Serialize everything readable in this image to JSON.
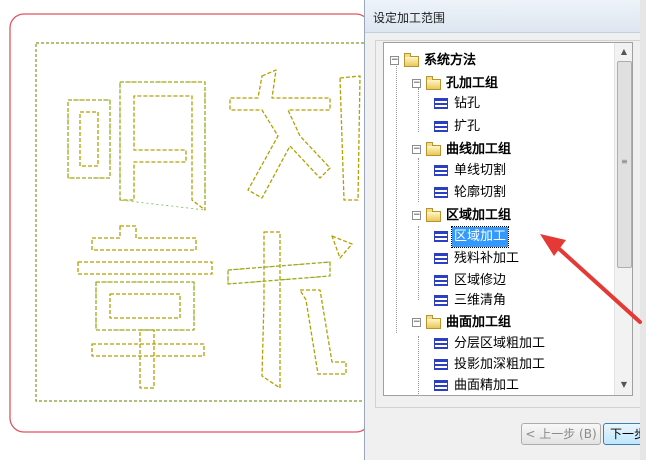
{
  "dialog": {
    "title": "设定加工范围",
    "tree": {
      "root": "系统方法",
      "groups": [
        {
          "label": "孔加工组",
          "items": [
            "钻孔",
            "扩孔"
          ]
        },
        {
          "label": "曲线加工组",
          "items": [
            "单线切割",
            "轮廓切割"
          ]
        },
        {
          "label": "区域加工组",
          "items": [
            "区域加工",
            "残料补加工",
            "区域修边",
            "三维清角"
          ],
          "selected": "区域加工"
        },
        {
          "label": "曲面加工组",
          "items": [
            "分层区域粗加工",
            "投影加深粗加工",
            "曲面精加工"
          ]
        }
      ]
    },
    "buttons": {
      "prev": "< 上一步 (B)",
      "next": "下一步"
    }
  },
  "colors": {
    "selection": "#3399ff",
    "arrow": "#e53935",
    "outline_border": "#e0545c",
    "stroke_green": "#4caf50",
    "stroke_yellow": "#d4b800"
  },
  "icons": {
    "collapse": "minus-box-icon",
    "folder": "folder-icon",
    "method": "method-list-icon",
    "arrow": "red-arrow-icon"
  }
}
